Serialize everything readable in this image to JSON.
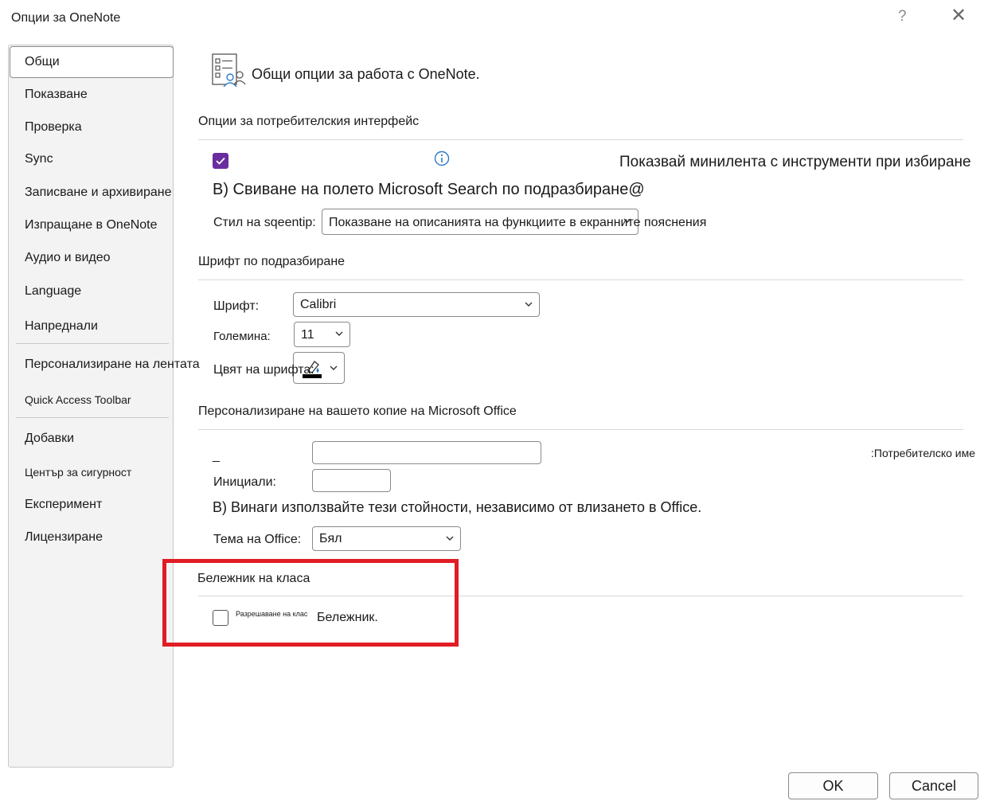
{
  "window": {
    "title": "Опции за OneNote",
    "help_glyph": "?",
    "close_glyph": "✕"
  },
  "sidebar": {
    "items": [
      {
        "label": "Общи",
        "selected": true
      },
      {
        "label": "Показване"
      },
      {
        "label": "Проверка"
      },
      {
        "label": "Sync"
      },
      {
        "label": "Записване и архивиране"
      },
      {
        "label": "Изпращане в OneNote"
      },
      {
        "label": "Аудио и видео"
      },
      {
        "label": "Language"
      },
      {
        "label": "Напреднали"
      },
      {
        "label": "Персонализиране на лентата"
      },
      {
        "label": "Quick Access Toolbar"
      },
      {
        "label": "Добавки"
      },
      {
        "label": "Център за сигурност"
      },
      {
        "label": "Експеримент"
      },
      {
        "label": "Лицензиране"
      }
    ]
  },
  "header": {
    "icon": "general-options-icon",
    "title": "Общи опции за работа с OneNote."
  },
  "ui_options": {
    "section_title": "Опции за потребителския интерфейс",
    "mini_toolbar_label": "Показвай минилента с инструменти при избиране",
    "mini_toolbar_checked": true,
    "info_icon": "info-icon",
    "collapse_search_label": "В) Свиване на полето Microsoft Search по подразбиране@",
    "screentip_label": "Стил на sqeentip:",
    "screentip_value": "Показване на описанията на функциите в екранните пояснения"
  },
  "default_font": {
    "section_title": "Шрифт по подразбиране",
    "font_label": "Шрифт:",
    "font_value": "Calibri",
    "size_label": "Големина:",
    "size_value": "11",
    "color_label": "Цвят на шрифта:",
    "color_value": "#000000"
  },
  "personalize": {
    "section_title": "Персонализиране на вашето копие на Microsoft Office",
    "username_label": ":Потребителско име",
    "username_underscore": "_",
    "username_value": "",
    "initials_label": "Инициали:",
    "initials_value": "",
    "always_use_label": "В) Винаги използвайте тези стойности, независимо от влизането в Office.",
    "theme_label": "Тема на Office:",
    "theme_value": "Бял"
  },
  "class_notebook": {
    "section_title": "Бележник на класа",
    "enable_small_label": "Разрешаване на клас",
    "enable_label": "Бележник.",
    "enable_checked": false
  },
  "footer": {
    "ok_label": "OK",
    "cancel_label": "Cancel"
  },
  "colors": {
    "accent": "#6a2d9e",
    "highlight": "#e01c24"
  }
}
